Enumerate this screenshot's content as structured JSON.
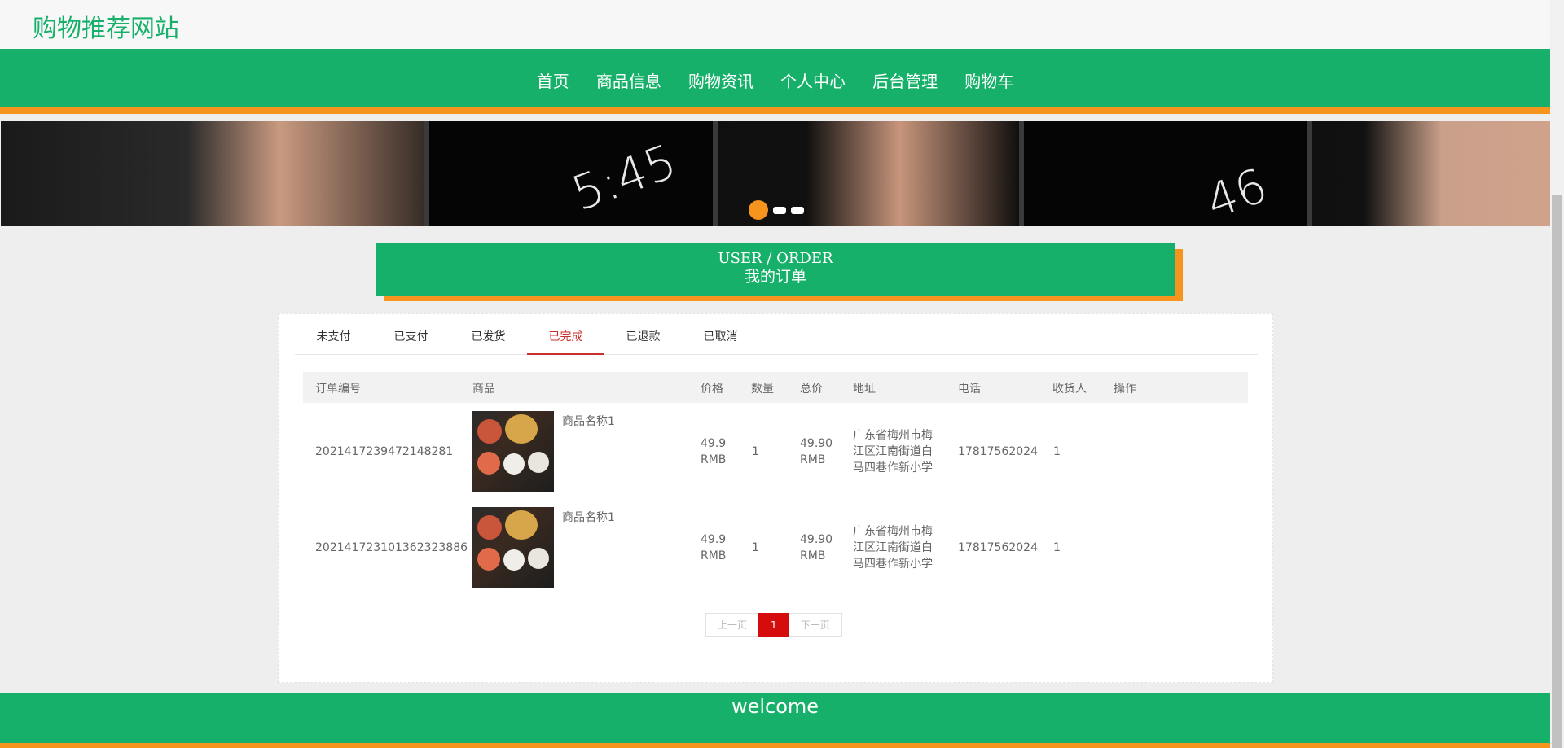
{
  "site": {
    "title": "购物推荐网站"
  },
  "nav": {
    "items": [
      "首页",
      "商品信息",
      "购物资讯",
      "个人中心",
      "后台管理",
      "购物车"
    ]
  },
  "banner": {
    "clock1": "5:45",
    "clock2": "46"
  },
  "section": {
    "title_en": "USER / ORDER",
    "title_cn": "我的订单"
  },
  "tabs": {
    "items": [
      "未支付",
      "已支付",
      "已发货",
      "已完成",
      "已退款",
      "已取消"
    ],
    "active": "已完成"
  },
  "table": {
    "headers": [
      "订单编号",
      "商品",
      "价格",
      "数量",
      "总价",
      "地址",
      "电话",
      "收货人",
      "操作"
    ],
    "rows": [
      {
        "order_no": "2021417239472148281",
        "product_name": "商品名称1",
        "price": "49.9",
        "price_unit": "RMB",
        "qty": "1",
        "total": "49.90",
        "total_unit": "RMB",
        "addr1": "广东省梅州市梅",
        "addr2": "江区江南街道白",
        "addr3": "马四巷作新小学",
        "phone": "17817562024",
        "receiver": "1"
      },
      {
        "order_no": "20214172310136232388​6",
        "product_name": "商品名称1",
        "price": "49.9",
        "price_unit": "RMB",
        "qty": "1",
        "total": "49.90",
        "total_unit": "RMB",
        "addr1": "广东省梅州市梅",
        "addr2": "江区江南街道白",
        "addr3": "马四巷作新小学",
        "phone": "17817562024",
        "receiver": "1"
      }
    ]
  },
  "pager": {
    "prev": "上一页",
    "current": "1",
    "next": "下一页"
  },
  "footer": {
    "text": "welcome"
  },
  "colors": {
    "primary": "#16b06a",
    "accent": "#f7941d",
    "active_tab": "#c9302c",
    "page_current": "#d50c0c"
  }
}
